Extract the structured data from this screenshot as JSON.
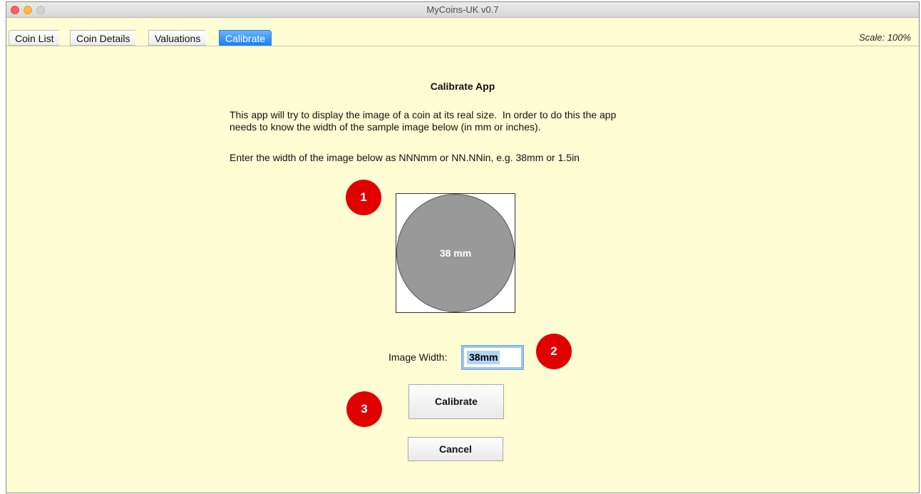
{
  "window": {
    "title": "MyCoins-UK v0.7"
  },
  "tabs": [
    {
      "label": "Coin List",
      "active": false
    },
    {
      "label": "Coin Details",
      "active": false
    },
    {
      "label": "Valuations",
      "active": false
    },
    {
      "label": "Calibrate",
      "active": true
    }
  ],
  "scale_label": "Scale:  100%",
  "calibrate": {
    "heading": "Calibrate App",
    "intro_line1": "This app will try to display the image of a coin at its real size.  In order to do this the app",
    "intro_line2": "needs to know the width of the sample image below (in mm or inches).",
    "instruction": "Enter the width of the image below as NNNmm or NN.NNin, e.g. 38mm or 1.5in",
    "sample_label": "38 mm",
    "width_label": "Image Width:",
    "width_value": "38mm",
    "calibrate_button": "Calibrate",
    "cancel_button": "Cancel"
  },
  "markers": [
    "1",
    "2",
    "3"
  ],
  "colors": {
    "content_background": "#fffdd3",
    "active_tab": "#1a82f7",
    "coin_fill": "#999999",
    "marker": "#e00000"
  }
}
